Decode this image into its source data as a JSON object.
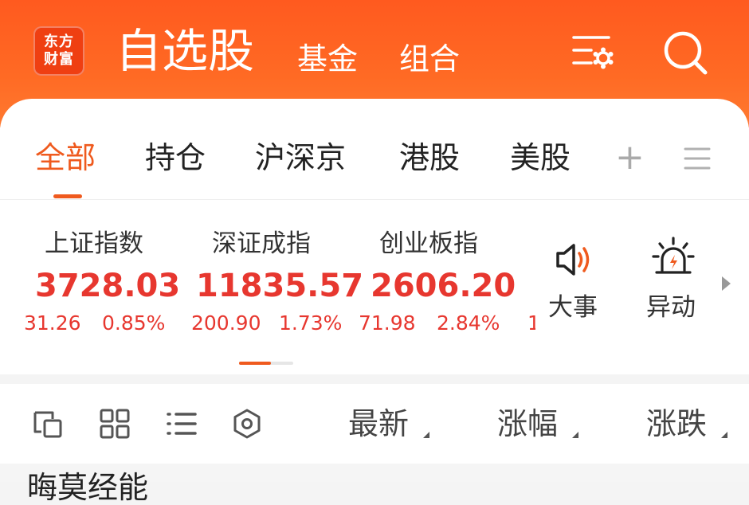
{
  "header": {
    "logo_line1": "东方",
    "logo_line2": "财富",
    "title": "自选股",
    "tabs": [
      "基金",
      "组合"
    ],
    "icons": [
      "settings-list-icon",
      "search-icon"
    ],
    "background": "#ff5a1f"
  },
  "tabs": {
    "items": [
      "全部",
      "持仓",
      "沪深京",
      "港股",
      "美股"
    ],
    "active_index": 0,
    "add_icon": "+",
    "menu_icon": "hamburger-icon",
    "accent": "#ef5a1e"
  },
  "indices": [
    {
      "name": "上证指数",
      "value": "3728.03",
      "change": "31.26",
      "percent": "0.85%"
    },
    {
      "name": "深证成指",
      "value": "11835.57",
      "change": "200.90",
      "percent": "1.73%"
    },
    {
      "name": "创业板指",
      "value": "2606.20",
      "change": "71.98",
      "percent": "2.84%"
    }
  ],
  "indices_clipped_text": "1",
  "quick_actions": [
    {
      "label": "大事",
      "icon": "speaker-icon"
    },
    {
      "label": "异动",
      "icon": "alarm-light-icon"
    }
  ],
  "toolbar": {
    "view_icons": [
      "card-view-icon",
      "grid-view-icon",
      "list-view-icon",
      "hexagon-settings-icon"
    ],
    "sort_columns": [
      "最新",
      "涨幅",
      "涨跌"
    ]
  },
  "list_partial": "晦莫经能",
  "colors": {
    "up": "#e7372f",
    "accent": "#ef5a1e"
  }
}
